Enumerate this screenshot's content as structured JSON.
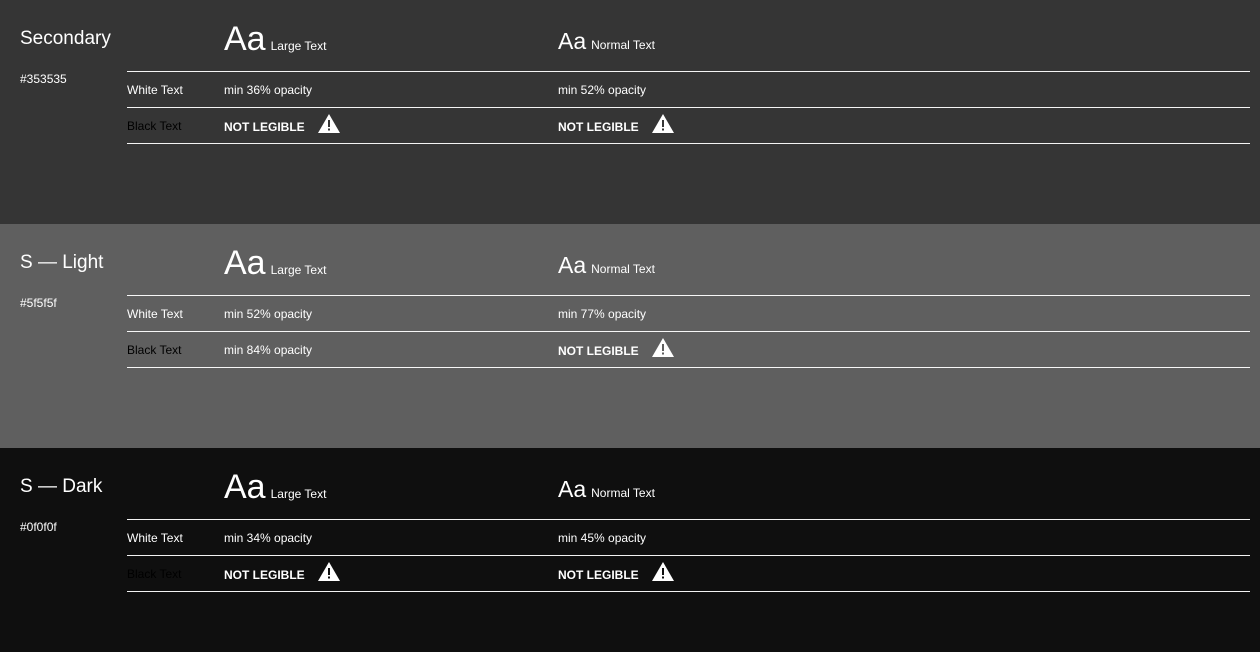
{
  "sections": [
    {
      "name": "Secondary",
      "hex": "#353535",
      "bg": "#353535",
      "large_aa": "Aa",
      "large_label": "Large Text",
      "normal_aa": "Aa",
      "normal_label": "Normal Text",
      "white_label": "White Text",
      "black_label": "Black Text",
      "white_large": "min 36% opacity",
      "white_normal": "min 52% opacity",
      "black_large": "NOT LEGIBLE",
      "black_normal": "NOT LEGIBLE"
    },
    {
      "name": "S — Light",
      "hex": "#5f5f5f",
      "bg": "#5f5f5f",
      "large_aa": "Aa",
      "large_label": "Large Text",
      "normal_aa": "Aa",
      "normal_label": "Normal Text",
      "white_label": "White Text",
      "black_label": "Black Text",
      "white_large": "min 52% opacity",
      "white_normal": "min 77% opacity",
      "black_large": "min 84% opacity",
      "black_normal": "NOT LEGIBLE"
    },
    {
      "name": "S — Dark",
      "hex": "#0f0f0f",
      "bg": "#0f0f0f",
      "large_aa": "Aa",
      "large_label": "Large Text",
      "normal_aa": "Aa",
      "normal_label": "Normal Text",
      "white_label": "White Text",
      "black_label": "Black Text",
      "white_large": "min 34% opacity",
      "white_normal": "min 45% opacity",
      "black_large": "NOT LEGIBLE",
      "black_normal": "NOT LEGIBLE"
    }
  ],
  "icons": {
    "warning": "warning-triangle-icon"
  }
}
